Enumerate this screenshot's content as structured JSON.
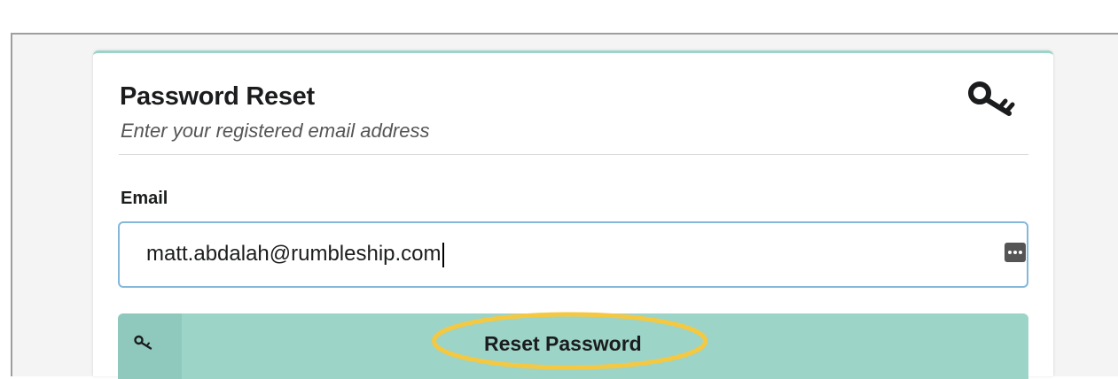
{
  "form": {
    "title": "Password Reset",
    "subtitle": "Enter your registered email address",
    "email_label": "Email",
    "email_value": "matt.abdalah@rumbleship.com",
    "submit_label": "Reset Password"
  },
  "colors": {
    "accent": "#9cd4c8",
    "button_icon_box": "#8fc9bd",
    "input_border": "#85b7d9",
    "highlight_ring": "#f5c842"
  },
  "icons": {
    "header": "key-icon",
    "button": "key-icon",
    "input_helper": "password-manager-icon"
  }
}
